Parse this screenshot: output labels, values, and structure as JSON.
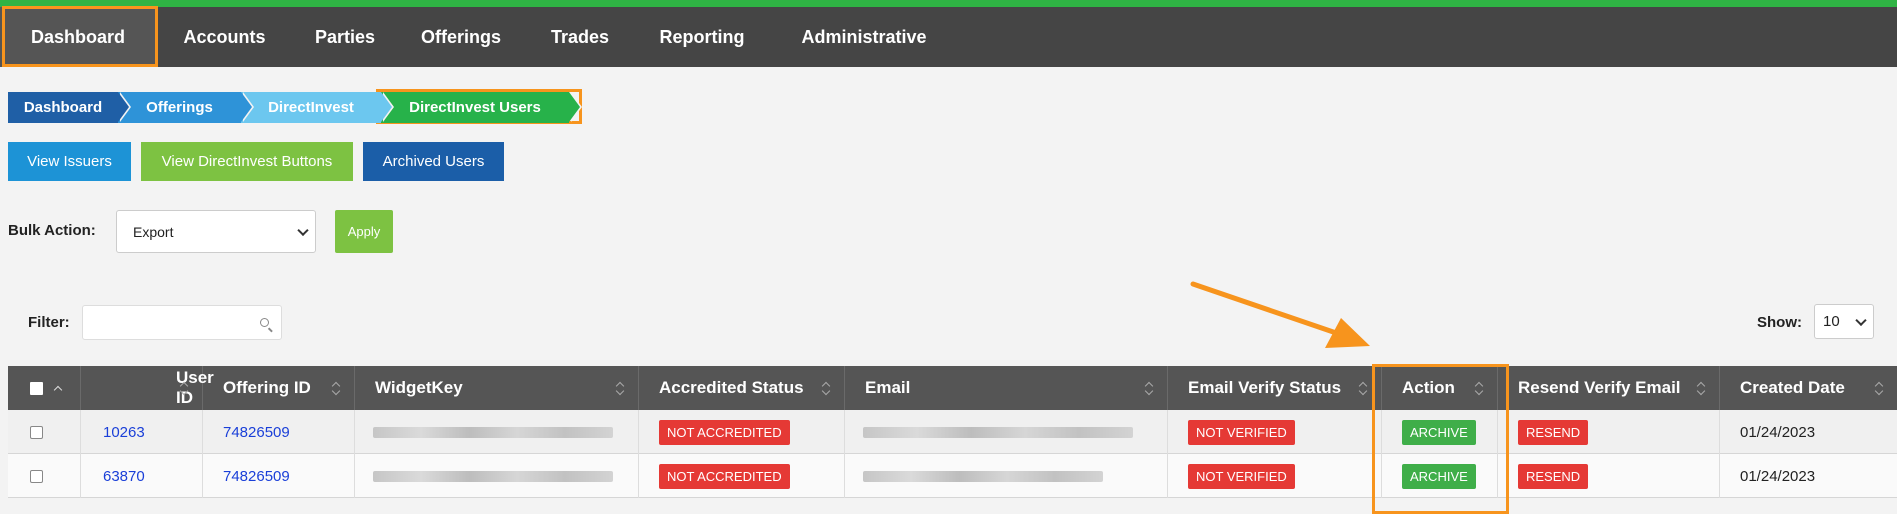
{
  "nav": {
    "items": [
      "Dashboard",
      "Accounts",
      "Parties",
      "Offerings",
      "Trades",
      "Reporting",
      "Administrative"
    ],
    "active": "Dashboard"
  },
  "breadcrumb": [
    "Dashboard",
    "Offerings",
    "DirectInvest",
    "DirectInvest Users"
  ],
  "buttons": {
    "view_issuers": "View Issuers",
    "view_directinvest_buttons": "View DirectInvest Buttons",
    "archived_users": "Archived Users",
    "apply": "Apply"
  },
  "bulk_action": {
    "label": "Bulk Action:",
    "selected": "Export"
  },
  "filter": {
    "label": "Filter:",
    "value": ""
  },
  "show": {
    "label": "Show:",
    "selected": "10"
  },
  "table": {
    "columns": [
      "User ID",
      "Offering ID",
      "WidgetKey",
      "Accredited Status",
      "Email",
      "Email Verify Status",
      "Action",
      "Resend Verify Email",
      "Created Date"
    ],
    "rows": [
      {
        "user_id": "10263",
        "offering_id": "74826509",
        "accredited": "NOT ACCREDITED",
        "email_verify": "NOT VERIFIED",
        "action": "ARCHIVE",
        "resend": "RESEND",
        "created": "01/24/2023"
      },
      {
        "user_id": "63870",
        "offering_id": "74826509",
        "accredited": "NOT ACCREDITED",
        "email_verify": "NOT VERIFIED",
        "action": "ARCHIVE",
        "resend": "RESEND",
        "created": "01/24/2023"
      }
    ]
  },
  "colors": {
    "nav_bg": "#454545",
    "top_line": "#2fb344",
    "highlight": "#f7941d",
    "crumb_1": "#1f5fa6",
    "crumb_2": "#2e93d8",
    "crumb_3": "#6cc7ef",
    "crumb_4": "#27b24a",
    "btn_issuers": "#1d93d6",
    "btn_directinvest": "#7dc242",
    "btn_archived": "#1b5ea8",
    "badge_red": "#e53935",
    "badge_green": "#3fae49"
  }
}
